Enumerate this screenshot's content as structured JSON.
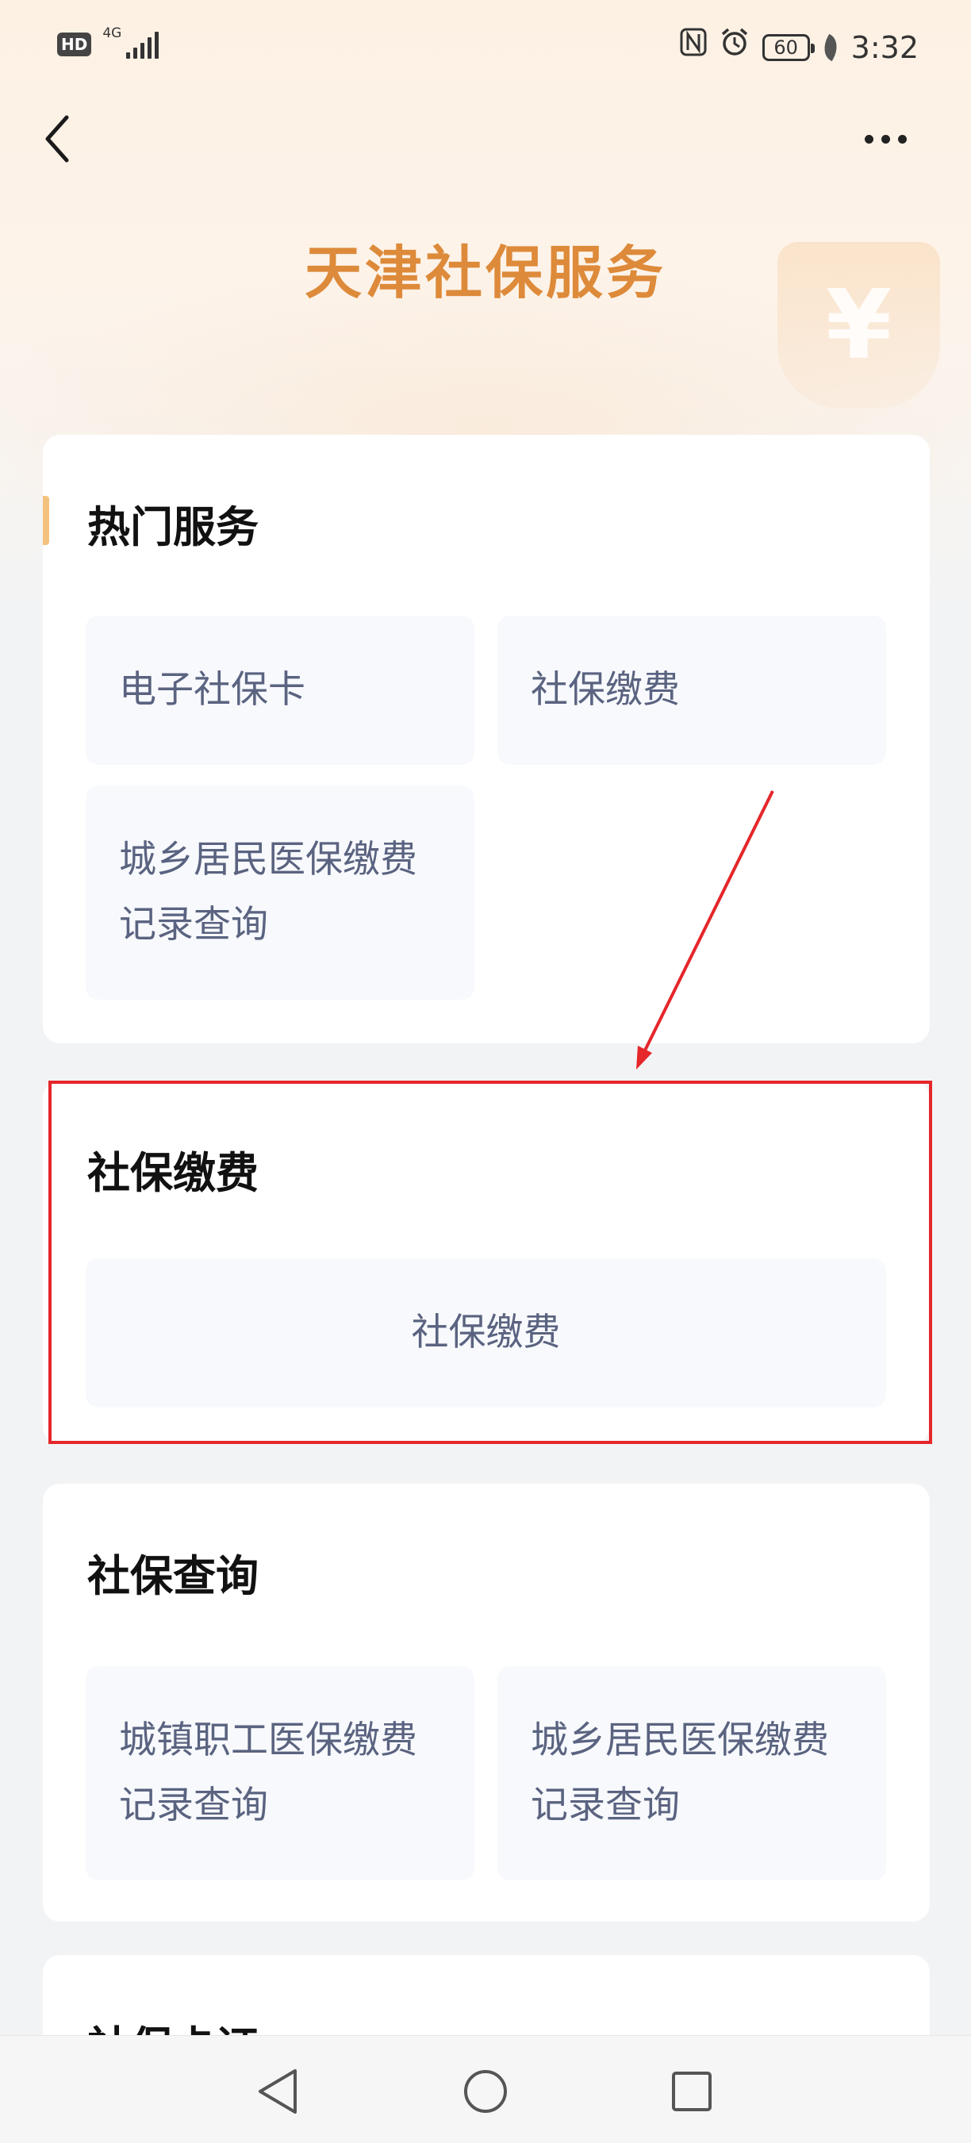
{
  "status_bar": {
    "hd": "HD",
    "network": "4G",
    "battery": "60",
    "time": "3:32"
  },
  "header": {
    "title": "天津社保服务",
    "deco_symbol": "¥"
  },
  "hot_services": {
    "title": "热门服务",
    "items": [
      {
        "label": "电子社保卡"
      },
      {
        "label": "社保缴费"
      },
      {
        "label": "城乡居民医保缴费\n记录查询"
      }
    ]
  },
  "payment": {
    "title": "社保缴费",
    "items": [
      {
        "label": "社保缴费"
      }
    ]
  },
  "query": {
    "title": "社保查询",
    "items": [
      {
        "label": "城镇职工医保缴费\n记录查询"
      },
      {
        "label": "城乡居民医保缴费\n记录查询"
      }
    ]
  },
  "next_section": {
    "title": "社保卡证"
  },
  "colors": {
    "title_orange": "#dd8a3a",
    "accent": "#f5c27d",
    "annotation_red": "#e5262a",
    "tile_text": "#5a6380"
  }
}
